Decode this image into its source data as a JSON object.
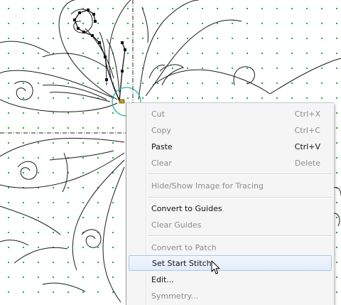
{
  "context_menu": {
    "items": [
      {
        "label": "Cut",
        "shortcut": "Ctrl+X",
        "enabled": false
      },
      {
        "label": "Copy",
        "shortcut": "Ctrl+C",
        "enabled": false
      },
      {
        "label": "Paste",
        "shortcut": "Ctrl+V",
        "enabled": true
      },
      {
        "label": "Clear",
        "shortcut": "Delete",
        "enabled": false
      },
      {
        "label": "Hide/Show Image for Tracing",
        "shortcut": "",
        "enabled": false
      },
      {
        "label": "Convert to Guides",
        "shortcut": "",
        "enabled": true
      },
      {
        "label": "Clear Guides",
        "shortcut": "",
        "enabled": false
      },
      {
        "label": "Convert to Patch",
        "shortcut": "",
        "enabled": false
      },
      {
        "label": "Set Start Stitch",
        "shortcut": "",
        "enabled": true,
        "highlighted": true
      },
      {
        "label": "Edit...",
        "shortcut": "",
        "enabled": true
      },
      {
        "label": "Symmetry...",
        "shortcut": "",
        "enabled": false
      }
    ]
  },
  "colors": {
    "grid_dot": "#1fae2e",
    "guide_line": "#222222",
    "pattern_stroke": "#1a1a1a",
    "selection_circle": "#2bb39a",
    "start_marker": "#c8a000",
    "highlight_border": "#a8c8ee"
  },
  "icons": {
    "cursor": "arrow-pointer-icon"
  }
}
